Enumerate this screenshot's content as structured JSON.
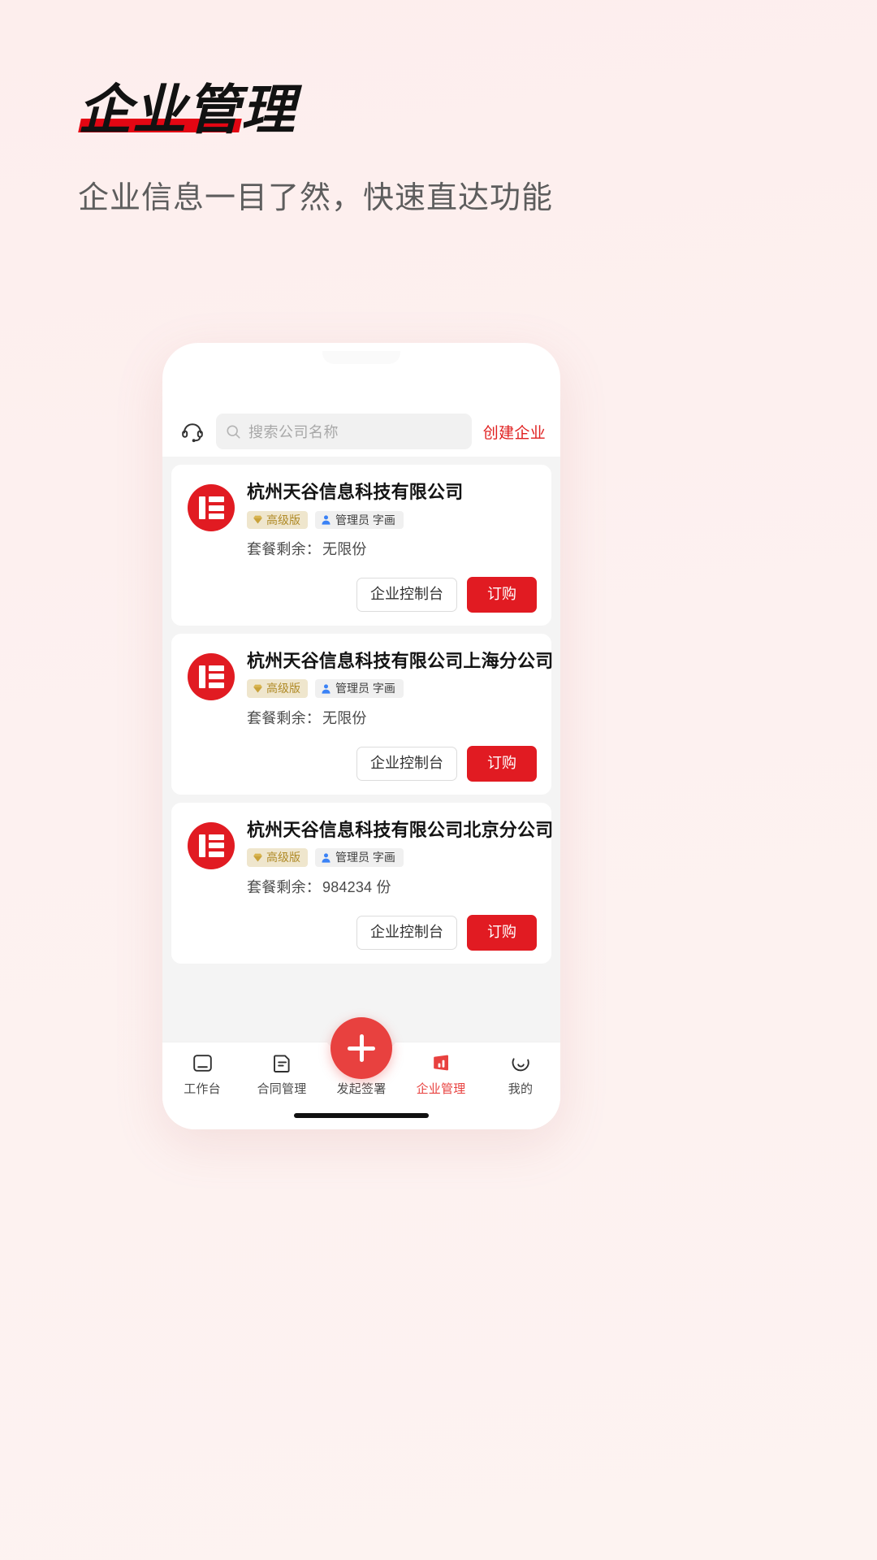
{
  "poster": {
    "title": "企业管理",
    "subtitle": "企业信息一目了然，快速直达功能",
    "accent_color": "#e30613",
    "background_color": "#fdf0ef"
  },
  "app": {
    "topbar": {
      "support_icon": "headset-icon",
      "search": {
        "icon": "search-icon",
        "placeholder": "搜索公司名称",
        "value": ""
      },
      "create_label": "创建企业",
      "create_color": "#e02020"
    },
    "companies": [
      {
        "logo_letter": "E",
        "name": "杭州天谷信息科技有限公司",
        "plan_badge": "高级版",
        "role_badge": "管理员 字画",
        "quota_label": "套餐剩余：",
        "quota_value": "无限份",
        "console_button": "企业控制台",
        "order_button": "订购"
      },
      {
        "logo_letter": "E",
        "name": "杭州天谷信息科技有限公司上海分公司",
        "plan_badge": "高级版",
        "role_badge": "管理员 字画",
        "quota_label": "套餐剩余：",
        "quota_value": "无限份",
        "console_button": "企业控制台",
        "order_button": "订购"
      },
      {
        "logo_letter": "E",
        "name": "杭州天谷信息科技有限公司北京分公司",
        "plan_badge": "高级版",
        "role_badge": "管理员 字画",
        "quota_label": "套餐剩余：",
        "quota_value": "984234 份",
        "console_button": "企业控制台",
        "order_button": "订购"
      }
    ],
    "fab": {
      "icon": "plus-icon"
    },
    "tabbar": {
      "active_color": "#e8413f",
      "items": [
        {
          "label": "工作台",
          "icon": "workbench-icon",
          "active": false
        },
        {
          "label": "合同管理",
          "icon": "contract-icon",
          "active": false
        },
        {
          "label": "发起签署",
          "icon": "plus-icon",
          "active": false
        },
        {
          "label": "企业管理",
          "icon": "enterprise-chart-icon",
          "active": true
        },
        {
          "label": "我的",
          "icon": "profile-smile-icon",
          "active": false
        }
      ]
    }
  }
}
